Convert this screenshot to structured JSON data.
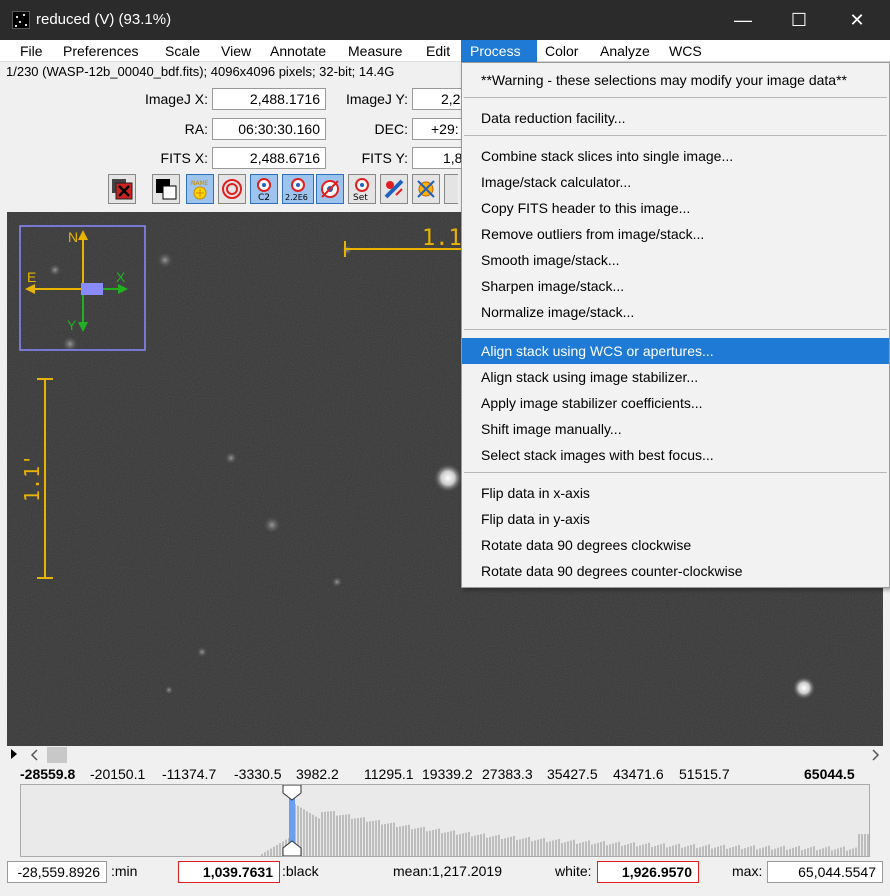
{
  "window": {
    "title": "reduced (V) (93.1%)",
    "controls": {
      "minimize": "—",
      "maximize": "☐",
      "close": "✕"
    }
  },
  "menubar": [
    "File",
    "Preferences",
    "Scale",
    "View",
    "Annotate",
    "Measure",
    "Edit",
    "Process",
    "Color",
    "Analyze",
    "WCS"
  ],
  "active_menu": "Process",
  "status_line": "1/230 (WASP-12b_00040_bdf.fits); 4096x4096 pixels; 32-bit; 14.4G",
  "coords": {
    "imagej_x_label": "ImageJ X:",
    "imagej_x": "2,488.1716",
    "imagej_y_label": "ImageJ Y:",
    "imagej_y": "2,2",
    "ra_label": "RA:",
    "ra": "06:30:30.160",
    "dec_label": "DEC:",
    "dec": "+29:",
    "fits_x_label": "FITS X:",
    "fits_x": "2,488.6716",
    "fits_y_label": "FITS Y:",
    "fits_y": "1,8"
  },
  "toolbar": {
    "tool_c2": "C2",
    "tool_2e6": "2.2E6",
    "tool_set": "Set"
  },
  "image_overlay": {
    "scale_h_label": "1.1",
    "scale_v_label": "1.1'",
    "compass_n": "N",
    "compass_e": "E",
    "compass_x": "X",
    "compass_y": "Y"
  },
  "histogram": {
    "ticks": [
      "-28559.8",
      "-20150.1",
      "-11374.7",
      "-3330.5",
      "3982.2",
      "11295.1",
      "19339.2",
      "27383.3",
      "35427.5",
      "43471.6",
      "51515.7",
      "65044.5"
    ]
  },
  "bottom": {
    "min_value": "-28,559.8926",
    "min_label": ":min",
    "black_value": "1,039.7631",
    "black_label": ":black",
    "mean_text": "mean:1,217.2019",
    "white_label": "white:",
    "white_value": "1,926.9570",
    "max_label": "max:",
    "max_value": "65,044.5547"
  },
  "process_menu": {
    "items": [
      {
        "label": "**Warning - these selections may modify your image data**"
      },
      {
        "label": "Data reduction facility..."
      },
      {
        "label": "Combine stack slices into single image..."
      },
      {
        "label": "Image/stack calculator..."
      },
      {
        "label": "Copy FITS header to this image..."
      },
      {
        "label": "Remove outliers from image/stack..."
      },
      {
        "label": "Smooth image/stack..."
      },
      {
        "label": "Sharpen image/stack..."
      },
      {
        "label": "Normalize image/stack..."
      },
      {
        "label": "Align stack using WCS or apertures..."
      },
      {
        "label": "Align stack using image stabilizer..."
      },
      {
        "label": "Apply image stabilizer coefficients..."
      },
      {
        "label": "Shift image manually..."
      },
      {
        "label": "Select stack images with best focus..."
      },
      {
        "label": "Flip data in x-axis"
      },
      {
        "label": "Flip data in y-axis"
      },
      {
        "label": "Rotate data 90 degrees clockwise"
      },
      {
        "label": "Rotate data 90 degrees counter-clockwise"
      }
    ],
    "highlighted": "Align stack using WCS or apertures..."
  },
  "colors": {
    "titlebar": "#2b2b2b",
    "menu_highlight": "#1e7ad4",
    "overlay_yellow": "#e8b400",
    "compass_green": "#22b022",
    "compass_box": "#8a8aff",
    "red_border": "#e02020"
  }
}
